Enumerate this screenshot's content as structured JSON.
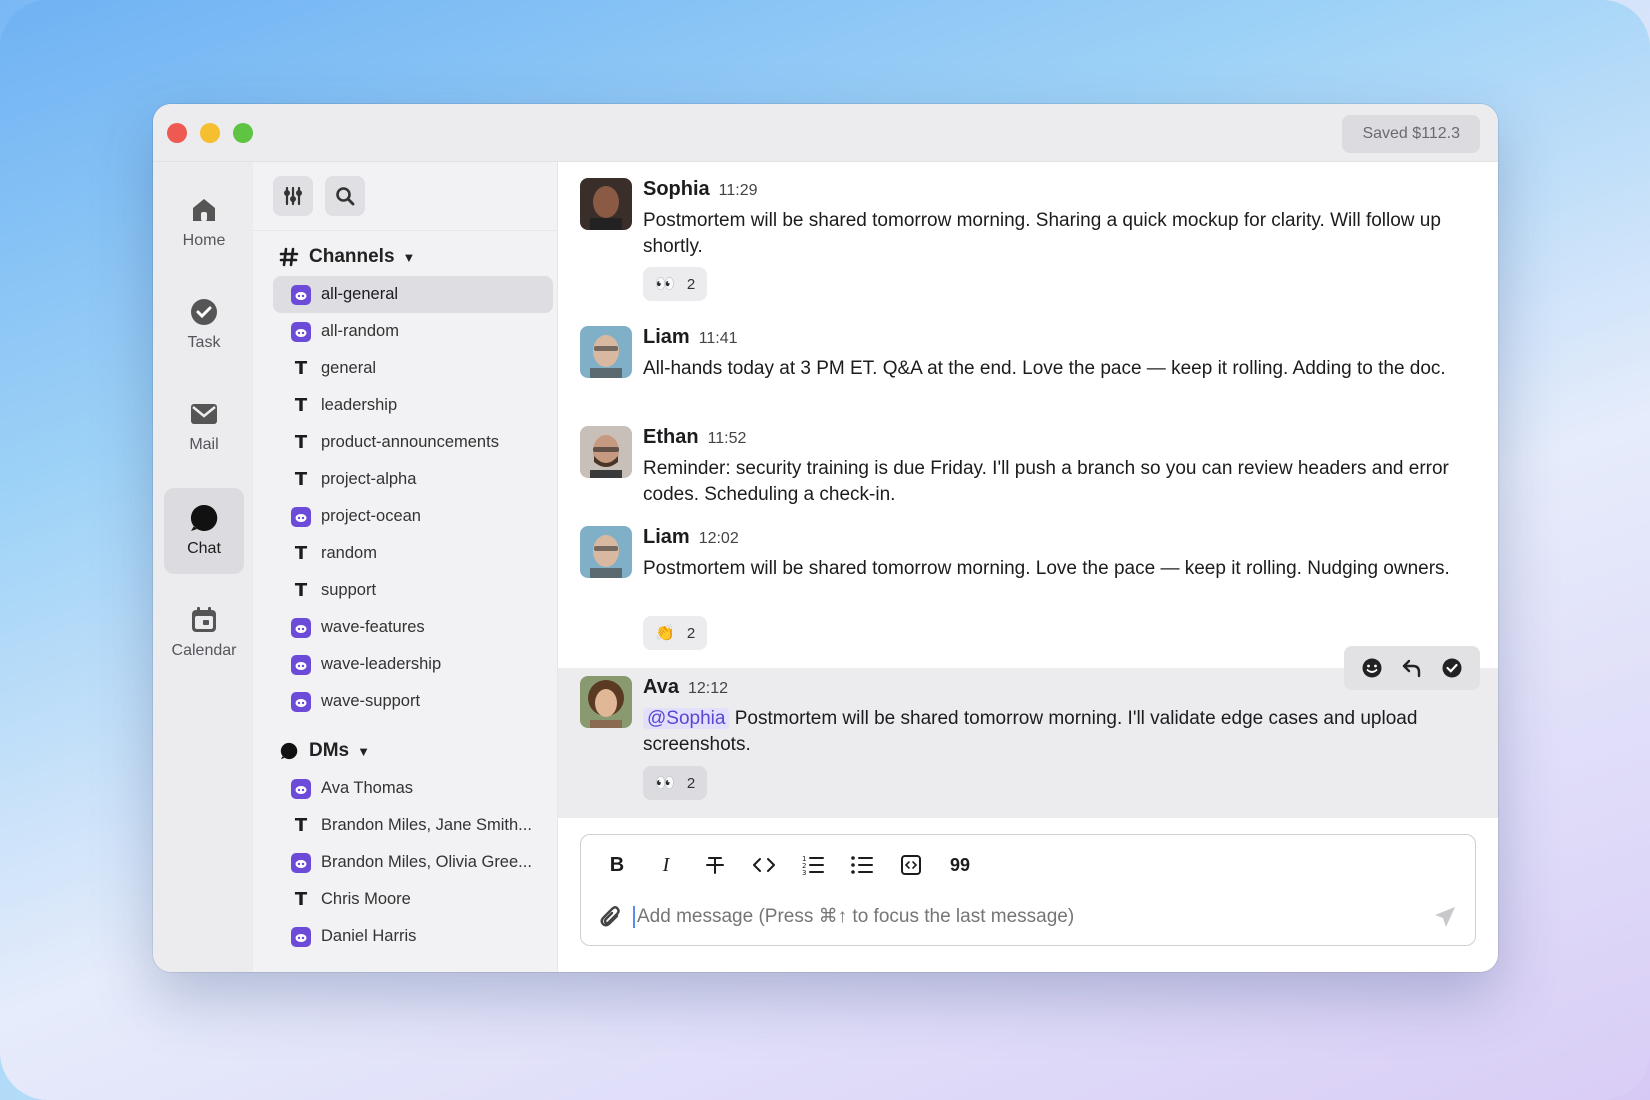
{
  "window": {
    "saved_badge": "Saved $112.3"
  },
  "rail": {
    "items": [
      {
        "label": "Home",
        "icon": "home-icon"
      },
      {
        "label": "Task",
        "icon": "check-circle-icon"
      },
      {
        "label": "Mail",
        "icon": "mail-icon"
      },
      {
        "label": "Chat",
        "icon": "chat-bubble-icon",
        "active": true
      },
      {
        "label": "Calendar",
        "icon": "calendar-icon"
      }
    ]
  },
  "sidebar": {
    "tools": [
      "filter-icon",
      "search-icon"
    ],
    "channels_header": "Channels",
    "channels": [
      {
        "name": "all-general",
        "icon": "bot",
        "active": true
      },
      {
        "name": "all-random",
        "icon": "bot"
      },
      {
        "name": "general",
        "icon": "T"
      },
      {
        "name": "leadership",
        "icon": "T"
      },
      {
        "name": "product-announcements",
        "icon": "T"
      },
      {
        "name": "project-alpha",
        "icon": "T"
      },
      {
        "name": "project-ocean",
        "icon": "bot"
      },
      {
        "name": "random",
        "icon": "T"
      },
      {
        "name": "support",
        "icon": "T"
      },
      {
        "name": "wave-features",
        "icon": "bot"
      },
      {
        "name": "wave-leadership",
        "icon": "bot"
      },
      {
        "name": "wave-support",
        "icon": "bot"
      }
    ],
    "dms_header": "DMs",
    "dms": [
      {
        "name": "Ava Thomas",
        "icon": "bot"
      },
      {
        "name": "Brandon Miles, Jane Smith...",
        "icon": "T"
      },
      {
        "name": "Brandon Miles, Olivia Gree...",
        "icon": "bot"
      },
      {
        "name": "Chris Moore",
        "icon": "T"
      },
      {
        "name": "Daniel Harris",
        "icon": "bot"
      }
    ]
  },
  "messages": [
    {
      "author": "Sophia",
      "time": "11:29",
      "text": "Postmortem will be shared tomorrow morning. Sharing a quick mockup for clarity. Will follow up shortly.",
      "reaction": {
        "emoji": "👀",
        "count": "2"
      },
      "avatar_color": "#6b4a3a"
    },
    {
      "author": "Liam",
      "time": "11:41",
      "text": "All-hands today at 3 PM ET. Q&A at the end. Love the pace — keep it rolling. Adding to the doc.",
      "avatar_color": "#8aa0a8"
    },
    {
      "author": "Ethan",
      "time": "11:52",
      "text": "Reminder: security training is due Friday. I'll push a branch so you can review headers and error codes. Scheduling a check-in.",
      "avatar_color": "#7a5a48"
    },
    {
      "author": "Liam",
      "time": "12:02",
      "text": "Postmortem will be shared tomorrow morning. Love the pace — keep it rolling. Nudging owners.",
      "reaction": {
        "emoji": "👏",
        "count": "2"
      },
      "avatar_color": "#8aa0a8"
    },
    {
      "author": "Ava",
      "time": "12:12",
      "mention": "@Sophia",
      "text": " Postmortem will be shared tomorrow morning. I'll validate edge cases and upload screenshots.",
      "reaction": {
        "emoji": "👀",
        "count": "2"
      },
      "avatar_color": "#6a5a40"
    }
  ],
  "hover_actions": [
    "emoji-icon",
    "reply-icon",
    "check-circle-icon"
  ],
  "composer": {
    "placeholder": "Add message (Press ⌘↑ to focus the last message)",
    "format_buttons": [
      "bold-icon",
      "italic-icon",
      "strikethrough-icon",
      "code-icon",
      "ordered-list-icon",
      "bullet-list-icon",
      "code-block-icon",
      "quote-icon"
    ],
    "bold_label": "B",
    "italic_label": "I",
    "quote_label": "99"
  }
}
